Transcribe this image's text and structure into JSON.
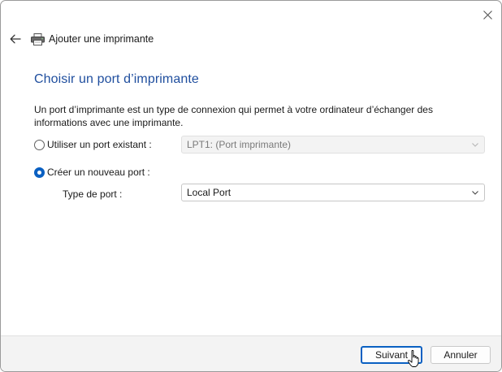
{
  "window": {
    "title": "Ajouter une imprimante"
  },
  "icons": {
    "close": "close-icon",
    "back": "back-arrow-icon",
    "printer": "printer-icon",
    "chevron": "chevron-down-icon"
  },
  "page": {
    "heading": "Choisir un port d’imprimante",
    "description": "Un port d’imprimante est un type de connexion qui permet à votre ordinateur d’échanger des informations avec une imprimante."
  },
  "options": {
    "existing_port": {
      "label": "Utiliser un port existant :",
      "selected": false,
      "select_value": "LPT1: (Port imprimante)",
      "enabled": false
    },
    "new_port": {
      "label": "Créer un nouveau port :",
      "selected": true,
      "type_label": "Type de port :",
      "select_value": "Local Port"
    }
  },
  "footer": {
    "next_label": "Suivant",
    "cancel_label": "Annuler"
  },
  "colors": {
    "accent": "#0a60c2",
    "heading": "#1f4e9e",
    "footer_bg": "#f3f3f3"
  }
}
